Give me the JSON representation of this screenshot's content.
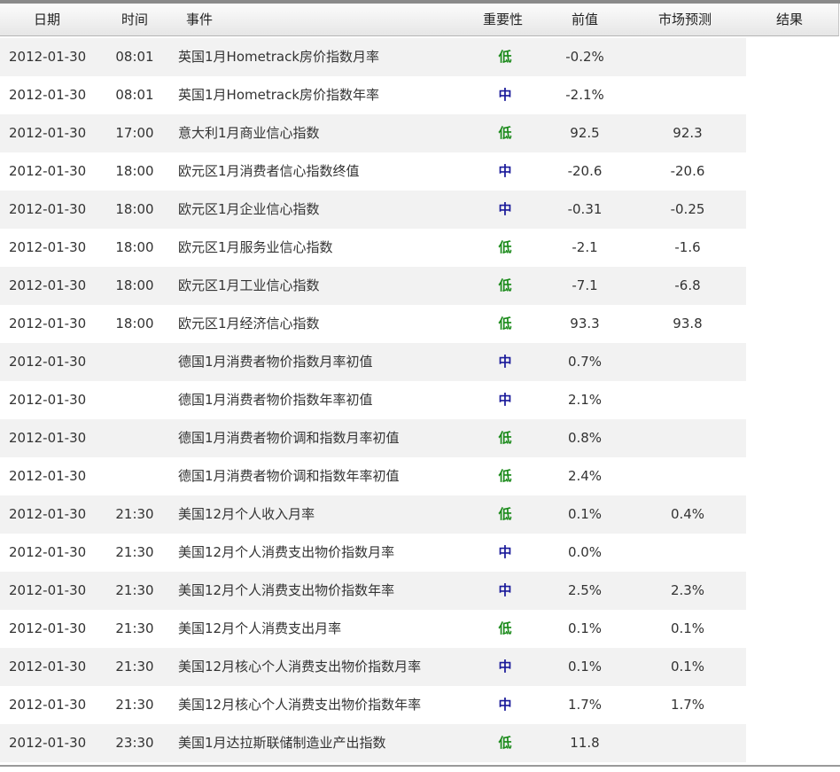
{
  "columns": {
    "date": "日期",
    "time": "时间",
    "event": "事件",
    "importance": "重要性",
    "previous": "前值",
    "forecast": "市场预测",
    "result": "结果"
  },
  "colors": {
    "importance_low": "#1a8a1a",
    "importance_mid": "#1a1a9a",
    "row_alt": "#f2f2f2",
    "header_bg": "#ececec"
  },
  "rows": [
    {
      "date": "2012-01-30",
      "time": "08:01",
      "event": "英国1月Hometrack房价指数月率",
      "importance": "低",
      "level": "low",
      "previous": "-0.2%",
      "forecast": ""
    },
    {
      "date": "2012-01-30",
      "time": "08:01",
      "event": "英国1月Hometrack房价指数年率",
      "importance": "中",
      "level": "mid",
      "previous": "-2.1%",
      "forecast": ""
    },
    {
      "date": "2012-01-30",
      "time": "17:00",
      "event": "意大利1月商业信心指数",
      "importance": "低",
      "level": "low",
      "previous": "92.5",
      "forecast": "92.3"
    },
    {
      "date": "2012-01-30",
      "time": "18:00",
      "event": "欧元区1月消费者信心指数终值",
      "importance": "中",
      "level": "mid",
      "previous": "-20.6",
      "forecast": "-20.6"
    },
    {
      "date": "2012-01-30",
      "time": "18:00",
      "event": "欧元区1月企业信心指数",
      "importance": "中",
      "level": "mid",
      "previous": "-0.31",
      "forecast": "-0.25"
    },
    {
      "date": "2012-01-30",
      "time": "18:00",
      "event": "欧元区1月服务业信心指数",
      "importance": "低",
      "level": "low",
      "previous": "-2.1",
      "forecast": "-1.6"
    },
    {
      "date": "2012-01-30",
      "time": "18:00",
      "event": "欧元区1月工业信心指数",
      "importance": "低",
      "level": "low",
      "previous": "-7.1",
      "forecast": "-6.8"
    },
    {
      "date": "2012-01-30",
      "time": "18:00",
      "event": "欧元区1月经济信心指数",
      "importance": "低",
      "level": "low",
      "previous": "93.3",
      "forecast": "93.8"
    },
    {
      "date": "2012-01-30",
      "time": "",
      "event": "德国1月消费者物价指数月率初值",
      "importance": "中",
      "level": "mid",
      "previous": "0.7%",
      "forecast": ""
    },
    {
      "date": "2012-01-30",
      "time": "",
      "event": "德国1月消费者物价指数年率初值",
      "importance": "中",
      "level": "mid",
      "previous": "2.1%",
      "forecast": ""
    },
    {
      "date": "2012-01-30",
      "time": "",
      "event": "德国1月消费者物价调和指数月率初值",
      "importance": "低",
      "level": "low",
      "previous": "0.8%",
      "forecast": ""
    },
    {
      "date": "2012-01-30",
      "time": "",
      "event": "德国1月消费者物价调和指数年率初值",
      "importance": "低",
      "level": "low",
      "previous": "2.4%",
      "forecast": ""
    },
    {
      "date": "2012-01-30",
      "time": "21:30",
      "event": "美国12月个人收入月率",
      "importance": "低",
      "level": "low",
      "previous": "0.1%",
      "forecast": "0.4%"
    },
    {
      "date": "2012-01-30",
      "time": "21:30",
      "event": "美国12月个人消费支出物价指数月率",
      "importance": "中",
      "level": "mid",
      "previous": "0.0%",
      "forecast": ""
    },
    {
      "date": "2012-01-30",
      "time": "21:30",
      "event": "美国12月个人消费支出物价指数年率",
      "importance": "中",
      "level": "mid",
      "previous": "2.5%",
      "forecast": "2.3%"
    },
    {
      "date": "2012-01-30",
      "time": "21:30",
      "event": "美国12月个人消费支出月率",
      "importance": "低",
      "level": "low",
      "previous": "0.1%",
      "forecast": "0.1%"
    },
    {
      "date": "2012-01-30",
      "time": "21:30",
      "event": "美国12月核心个人消费支出物价指数月率",
      "importance": "中",
      "level": "mid",
      "previous": "0.1%",
      "forecast": "0.1%"
    },
    {
      "date": "2012-01-30",
      "time": "21:30",
      "event": "美国12月核心个人消费支出物价指数年率",
      "importance": "中",
      "level": "mid",
      "previous": "1.7%",
      "forecast": "1.7%"
    },
    {
      "date": "2012-01-30",
      "time": "23:30",
      "event": "美国1月达拉斯联储制造业产出指数",
      "importance": "低",
      "level": "low",
      "previous": "11.8",
      "forecast": ""
    }
  ]
}
